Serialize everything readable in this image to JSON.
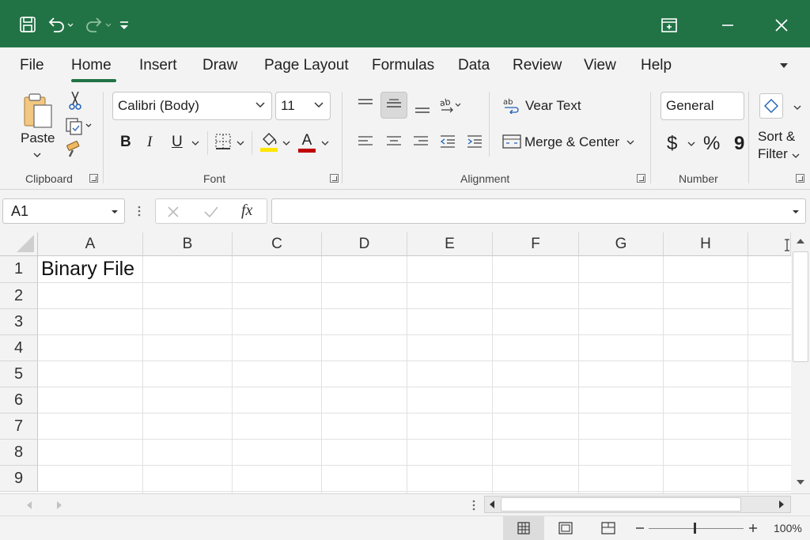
{
  "colors": {
    "brand": "#217346",
    "ribbon": "#f3f3f3",
    "font_underline": "#c00000",
    "highlight": "#ffe600"
  },
  "titlebar": {
    "icons": [
      "save-icon",
      "undo-icon",
      "redo-icon",
      "customize-qat-icon",
      "ribbon-display-icon",
      "minimize-icon",
      "close-icon"
    ]
  },
  "menu": {
    "tabs": [
      "File",
      "Home",
      "Insert",
      "Draw",
      "Page Layout",
      "Formulas",
      "Data",
      "Review",
      "View",
      "Help"
    ],
    "active": "Home"
  },
  "ribbon": {
    "clipboard": {
      "paste_label": "Paste",
      "group_label": "Clipboard"
    },
    "font": {
      "font_name": "Calibri (Body)",
      "font_size": "11",
      "bold": "B",
      "italic": "I",
      "underline": "U",
      "font_color_glyph": "A",
      "group_label": "Font"
    },
    "alignment": {
      "wrap_text": "Vear Text",
      "merge_center": "Merge & Center",
      "group_label": "Alignment"
    },
    "number": {
      "format": "General",
      "currency": "$",
      "percent": "%",
      "comma": "9",
      "group_label": "Number"
    },
    "editing": {
      "sort_label": "Sort &",
      "filter_label": "Filter"
    }
  },
  "formula_bar": {
    "name_box": "A1",
    "fx": "fx",
    "value": ""
  },
  "grid": {
    "columns": [
      "A",
      "B",
      "C",
      "D",
      "E",
      "F",
      "G",
      "H"
    ],
    "rows": [
      "1",
      "2",
      "3",
      "4",
      "5",
      "6",
      "7",
      "8",
      "9"
    ],
    "cells": {
      "A1": "Binary File"
    }
  },
  "status": {
    "zoom": "100%"
  }
}
